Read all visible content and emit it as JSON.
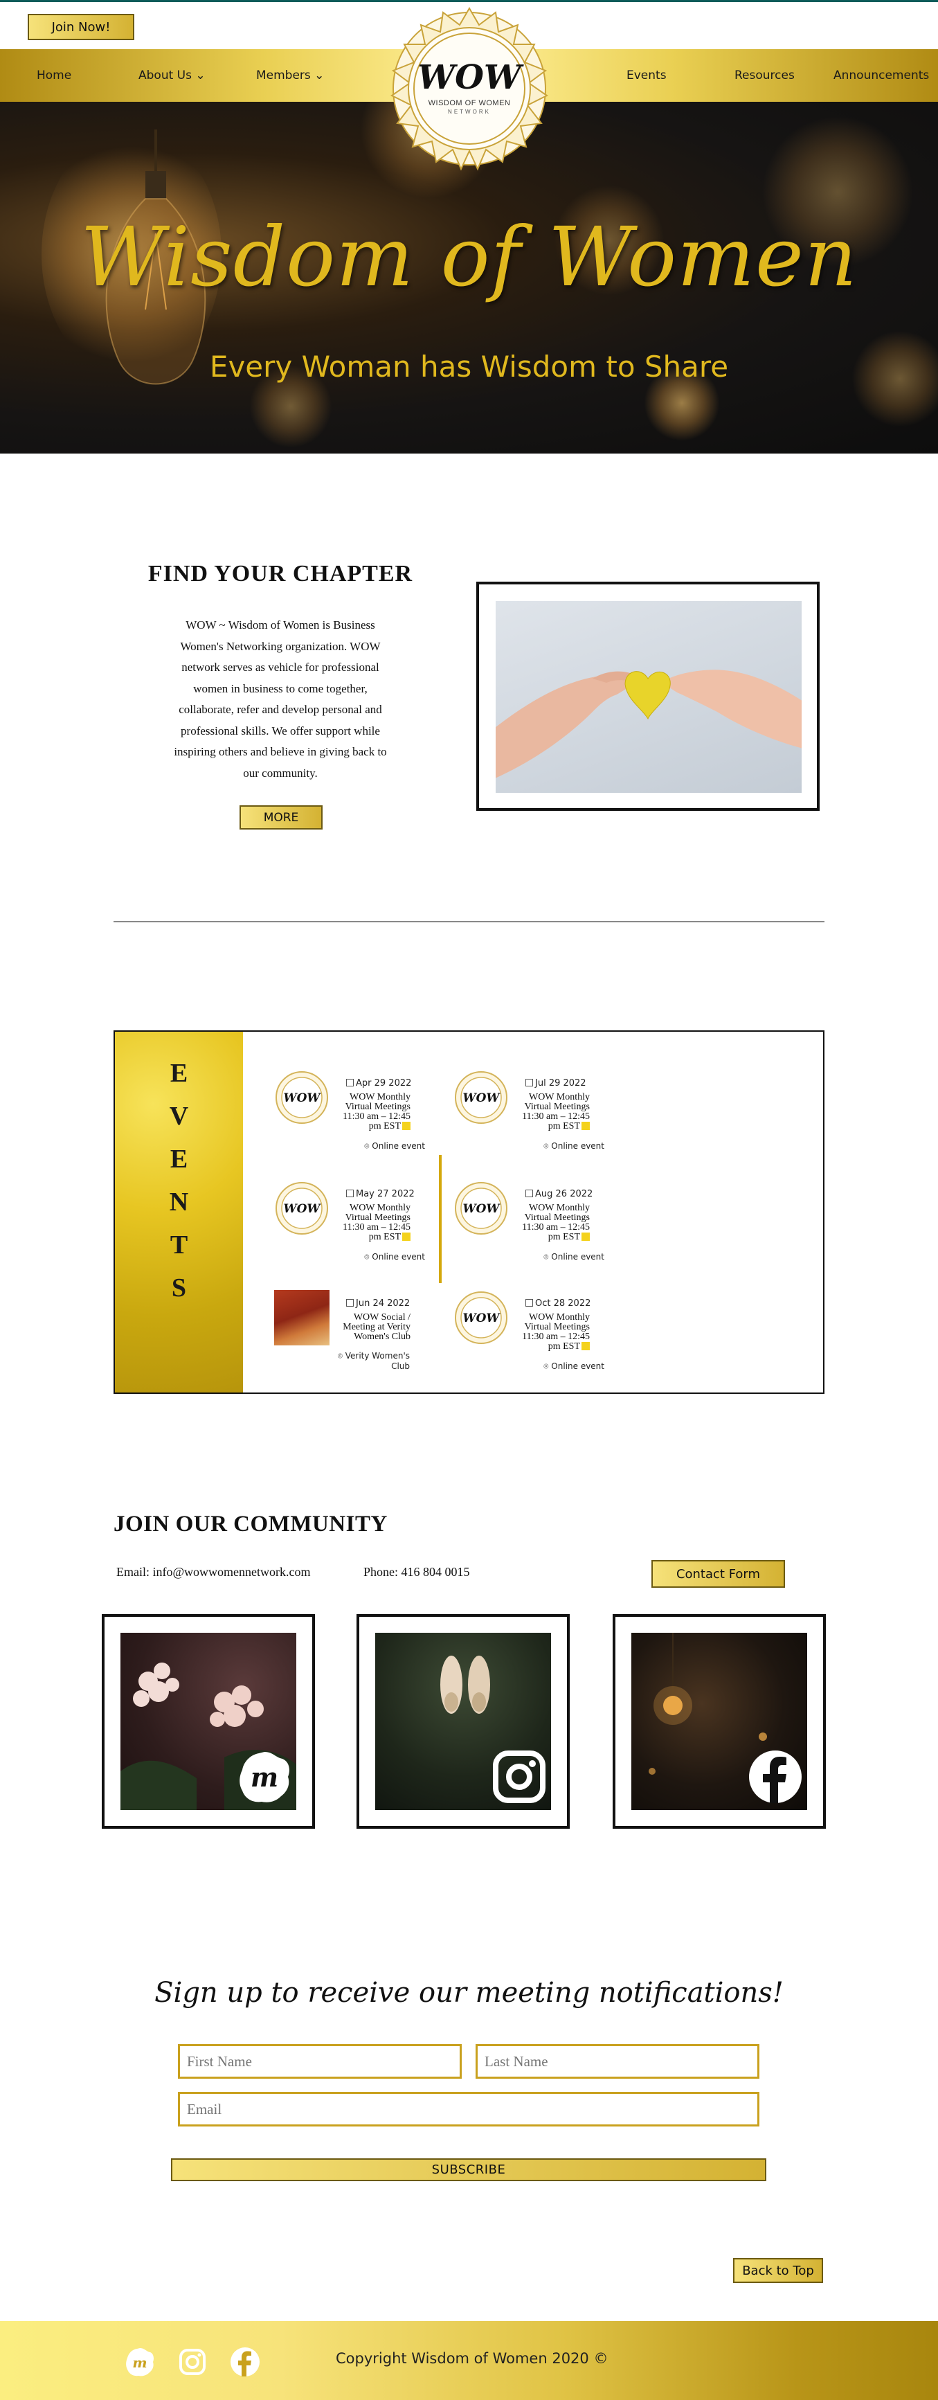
{
  "header": {
    "join_button": "Join Now!",
    "nav": [
      {
        "label": "Home"
      },
      {
        "label": "About Us ⌄"
      },
      {
        "label": "Members ⌄"
      },
      {
        "label": "Events"
      },
      {
        "label": "Resources"
      },
      {
        "label": "Announcements"
      }
    ],
    "logo": {
      "mark": "WOW",
      "line1": "WISDOM OF WOMEN",
      "line2": "NETWORK"
    }
  },
  "hero": {
    "title": "Wisdom of Women",
    "subtitle": "Every Woman has Wisdom to Share"
  },
  "chapter": {
    "title": "FIND YOUR CHAPTER",
    "text": "WOW ~ Wisdom of Women is Business Women's Networking organization. WOW network serves as vehicle for professional women in business to come together, collaborate, refer and develop personal and professional skills. We offer support while inspiring others and believe in giving back to our community.",
    "more_button": "MORE"
  },
  "events": {
    "side_letters": [
      "E",
      "V",
      "E",
      "N",
      "T",
      "S"
    ],
    "items": [
      {
        "date": "Apr 29 2022",
        "title": [
          "WOW Monthly",
          "Virtual Meetings",
          "11:30 am – 12:45",
          "pm EST"
        ],
        "location": "Online event",
        "thumb": "logo"
      },
      {
        "date": "May 27 2022",
        "title": [
          "WOW Monthly",
          "Virtual Meetings",
          "11:30 am – 12:45",
          "pm EST"
        ],
        "location": "Online event",
        "thumb": "logo"
      },
      {
        "date": "Jun 24 2022",
        "title": [
          "WOW Social /",
          "Meeting at Verity",
          "Women's Club"
        ],
        "location": "Verity Women's Club",
        "thumb": "photo"
      },
      {
        "date": "Jul 29 2022",
        "title": [
          "WOW Monthly",
          "Virtual Meetings",
          "11:30 am – 12:45",
          "pm EST"
        ],
        "location": "Online event",
        "thumb": "logo"
      },
      {
        "date": "Aug 26 2022",
        "title": [
          "WOW Monthly",
          "Virtual Meetings",
          "11:30 am – 12:45",
          "pm EST"
        ],
        "location": "Online event",
        "thumb": "logo"
      },
      {
        "date": "Oct 28 2022",
        "title": [
          "WOW Monthly",
          "Virtual Meetings",
          "11:30 am – 12:45",
          "pm EST"
        ],
        "location": "Online event",
        "thumb": "logo"
      }
    ]
  },
  "community": {
    "title": "JOIN OUR COMMUNITY",
    "email": "Email: info@wowwomennetwork.com",
    "phone": "Phone: 416 804 0015",
    "contact_button": "Contact Form",
    "socials": [
      {
        "icon": "meetup-icon"
      },
      {
        "icon": "instagram-icon"
      },
      {
        "icon": "facebook-icon"
      }
    ]
  },
  "signup": {
    "title": "Sign up to receive our meeting notifications!",
    "first_name_placeholder": "First Name",
    "last_name_placeholder": "Last Name",
    "email_placeholder": "Email",
    "subscribe_button": "SUBSCRIBE"
  },
  "back_to_top": "Back to Top",
  "footer": {
    "copyright": "Copyright Wisdom of Women 2020 ©",
    "icons": [
      "meetup-icon",
      "instagram-icon",
      "facebook-icon"
    ]
  },
  "colors": {
    "gold": "#e0b81e",
    "gold_dark": "#b08b14",
    "teal": "#0d5c5a"
  }
}
